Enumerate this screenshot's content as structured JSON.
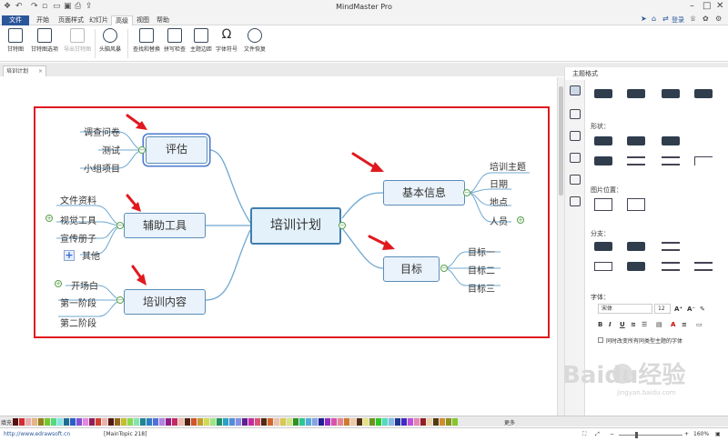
{
  "window": {
    "title": "MindMaster Pro",
    "login": "登录"
  },
  "menu": [
    "文件",
    "开始",
    "页面样式",
    "幻灯片",
    "高级",
    "视图",
    "帮助"
  ],
  "ribbon": [
    {
      "label": "甘特图",
      "dim": false
    },
    {
      "label": "甘特图选项",
      "dim": false
    },
    {
      "label": "导出甘特图",
      "dim": true
    },
    {
      "label": "头脑风暴",
      "dim": false
    },
    {
      "label": "查找和替换",
      "dim": false
    },
    {
      "label": "拼写检查",
      "dim": false
    },
    {
      "label": "主题边距",
      "dim": false
    },
    {
      "label": "字体符号",
      "dim": false
    },
    {
      "label": "文件恢复",
      "dim": false
    }
  ],
  "doc_tab": {
    "label": "培训计划"
  },
  "mindmap": {
    "central": "培训计划",
    "evaluate": {
      "title": "评估",
      "children": [
        "调查问卷",
        "测试",
        "小组项目"
      ]
    },
    "aux": {
      "title": "辅助工具",
      "children": [
        "文件资料",
        "视觉工具",
        "宣传册子",
        "其他"
      ]
    },
    "content": {
      "title": "培训内容",
      "children": [
        "开场白",
        "第一阶段",
        "第二阶段"
      ]
    },
    "basic": {
      "title": "基本信息",
      "children": [
        "培训主题",
        "日期",
        "地点",
        "人员"
      ]
    },
    "goal": {
      "title": "目标",
      "children": [
        "目标一",
        "目标二",
        "目标三"
      ]
    }
  },
  "panel": {
    "title": "主题格式",
    "shape": "形状：",
    "image_pos": "图片位置：",
    "branch": "分支：",
    "font": "字体：",
    "font_name": "宋体",
    "font_size": "12",
    "apply_all": "同时改变所有同类型主题的字体"
  },
  "palette": {
    "label": "填充",
    "more": "更多"
  },
  "colors": {
    "accent": "#2b579a",
    "highlight": "#e0191f",
    "topic_border": "#5b8db8",
    "topic_fill": "#eaf3fb",
    "line": "#6fa8d0"
  },
  "status": {
    "url": "http://www.edrawsoft.cn",
    "topic": "[MainTopic 218]",
    "zoom": "160%"
  },
  "watermark": {
    "text": "Baidu经验",
    "sub": "jingyan.baidu.com"
  }
}
